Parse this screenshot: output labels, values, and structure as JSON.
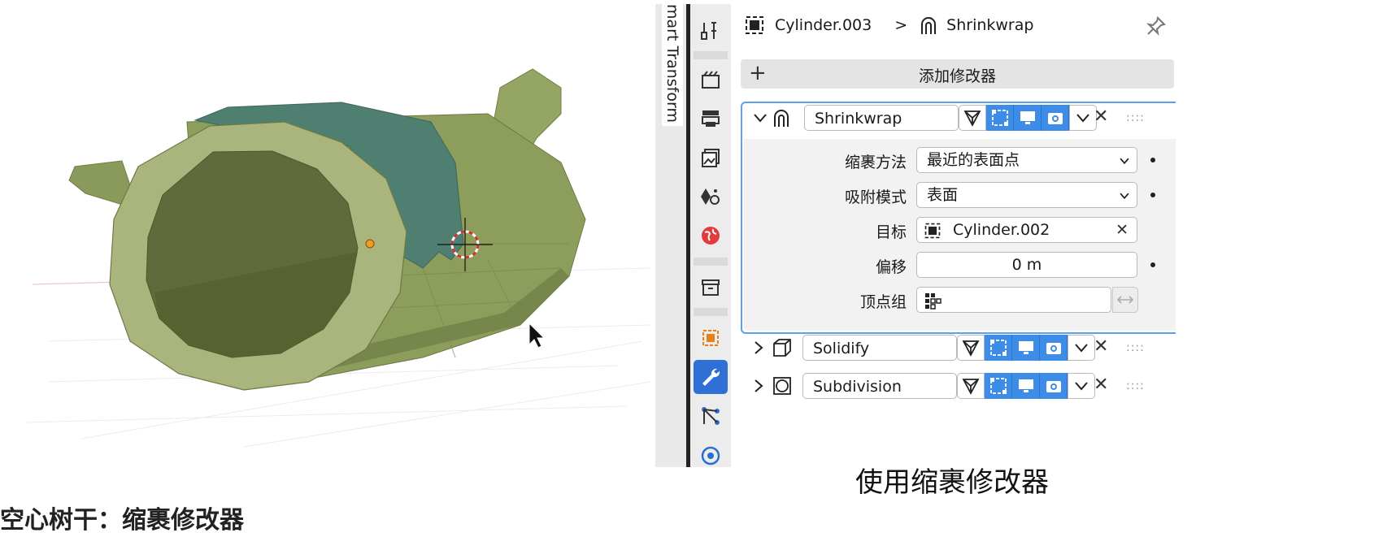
{
  "viewport": {
    "npanel_tab_label": "mart Transform",
    "caption": "空心树干：缩裹修改器"
  },
  "properties_tabs": [
    {
      "icon": "tool-icon"
    },
    {
      "icon": "render-icon"
    },
    {
      "icon": "output-icon"
    },
    {
      "icon": "view-layer-icon"
    },
    {
      "icon": "scene-icon"
    },
    {
      "icon": "world-icon"
    },
    {
      "icon": "collection-icon"
    },
    {
      "icon": "object-icon"
    },
    {
      "icon": "modifier-wrench-icon",
      "active": true
    },
    {
      "icon": "particles-icon"
    },
    {
      "icon": "physics-icon"
    }
  ],
  "breadcrumb": {
    "object": "Cylinder.003",
    "separator": ">",
    "modifier": "Shrinkwrap"
  },
  "add_modifier_label": "添加修改器",
  "add_modifier_plus": "+",
  "modifiers": [
    {
      "name": "Shrinkwrap",
      "expanded": true,
      "fields": {
        "wrap_method_label": "缩裹方法",
        "wrap_method_value": "最近的表面点",
        "snap_mode_label": "吸附模式",
        "snap_mode_value": "表面",
        "target_label": "目标",
        "target_value": "Cylinder.002",
        "offset_label": "偏移",
        "offset_value": "0 m",
        "vertex_group_label": "顶点组",
        "vertex_group_value": ""
      }
    },
    {
      "name": "Solidify",
      "expanded": false
    },
    {
      "name": "Subdivision",
      "expanded": false
    }
  ],
  "caption_right": "使用缩裹修改器",
  "colors": {
    "accent_blue": "#3d8ce8",
    "active_tab": "#2f6fd6",
    "trunk_green": "#8d9d5c",
    "moss_teal": "#4f7f70"
  }
}
